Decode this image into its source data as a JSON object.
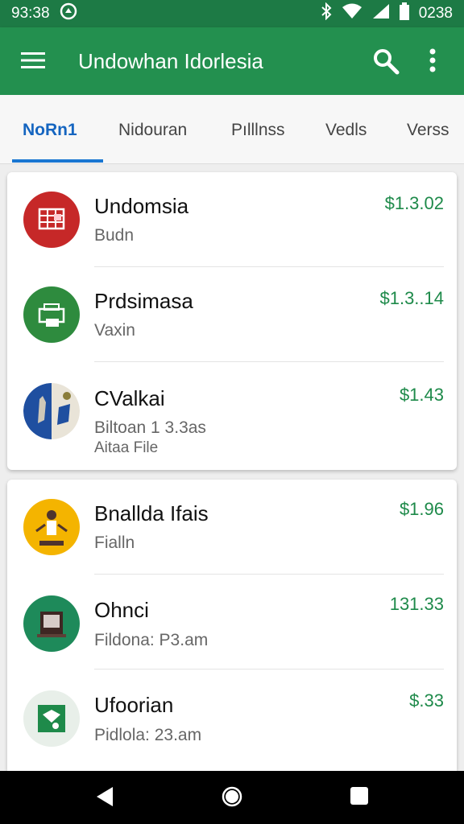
{
  "status_bar": {
    "time_left": "93:38",
    "time_right": "0238",
    "icons": [
      "sync-icon",
      "bluetooth-icon",
      "wifi-icon",
      "signal-icon",
      "battery-icon"
    ]
  },
  "app_bar": {
    "title": "Undowhan Idorlesia",
    "icons": [
      "menu-icon",
      "search-icon",
      "more-vert-icon"
    ]
  },
  "tabs": [
    {
      "label": "NoRn1",
      "active": true
    },
    {
      "label": "Nidouran",
      "active": false
    },
    {
      "label": "Pılllnss",
      "active": false
    },
    {
      "label": "Vedls",
      "active": false
    },
    {
      "label": "Verss",
      "active": false
    }
  ],
  "cards": [
    {
      "items": [
        {
          "name": "Undomsia",
          "sub": "Budn",
          "price": "$1.3.02",
          "avatar_color": "#c62828",
          "icon": "chart-icon"
        },
        {
          "name": "Prdsimasa",
          "sub": "Vaxin",
          "price": "$1.3..14",
          "avatar_color": "#2e8b3e",
          "icon": "printer-icon"
        },
        {
          "name": "CValkai",
          "sub": "Biltoan 1 3.3as",
          "sub2": "Aitaa File",
          "price": "$1.43",
          "avatar_color": "#1f4fa0",
          "icon": "map-icon"
        }
      ]
    },
    {
      "items": [
        {
          "name": "Bnallda Ifais",
          "sub": "Fialln",
          "price": "$1.96",
          "avatar_color": "#f4b400",
          "icon": "person-icon"
        },
        {
          "name": "Ohnci",
          "sub": "Fildona: P3.am",
          "price": "131.33",
          "avatar_color": "#1e8a5a",
          "icon": "box-icon"
        },
        {
          "name": "Ufoorian",
          "sub": "Pidlola: 23.am",
          "price": "$.33",
          "avatar_color": "#e8efe9",
          "icon": "badge-icon"
        }
      ]
    }
  ],
  "nav_bar": {
    "buttons": [
      "back-icon",
      "home-icon",
      "recents-icon"
    ]
  },
  "colors": {
    "primary": "#23904f",
    "status": "#1d7a45",
    "accent": "#1976d2",
    "price": "#1e8a4a"
  }
}
